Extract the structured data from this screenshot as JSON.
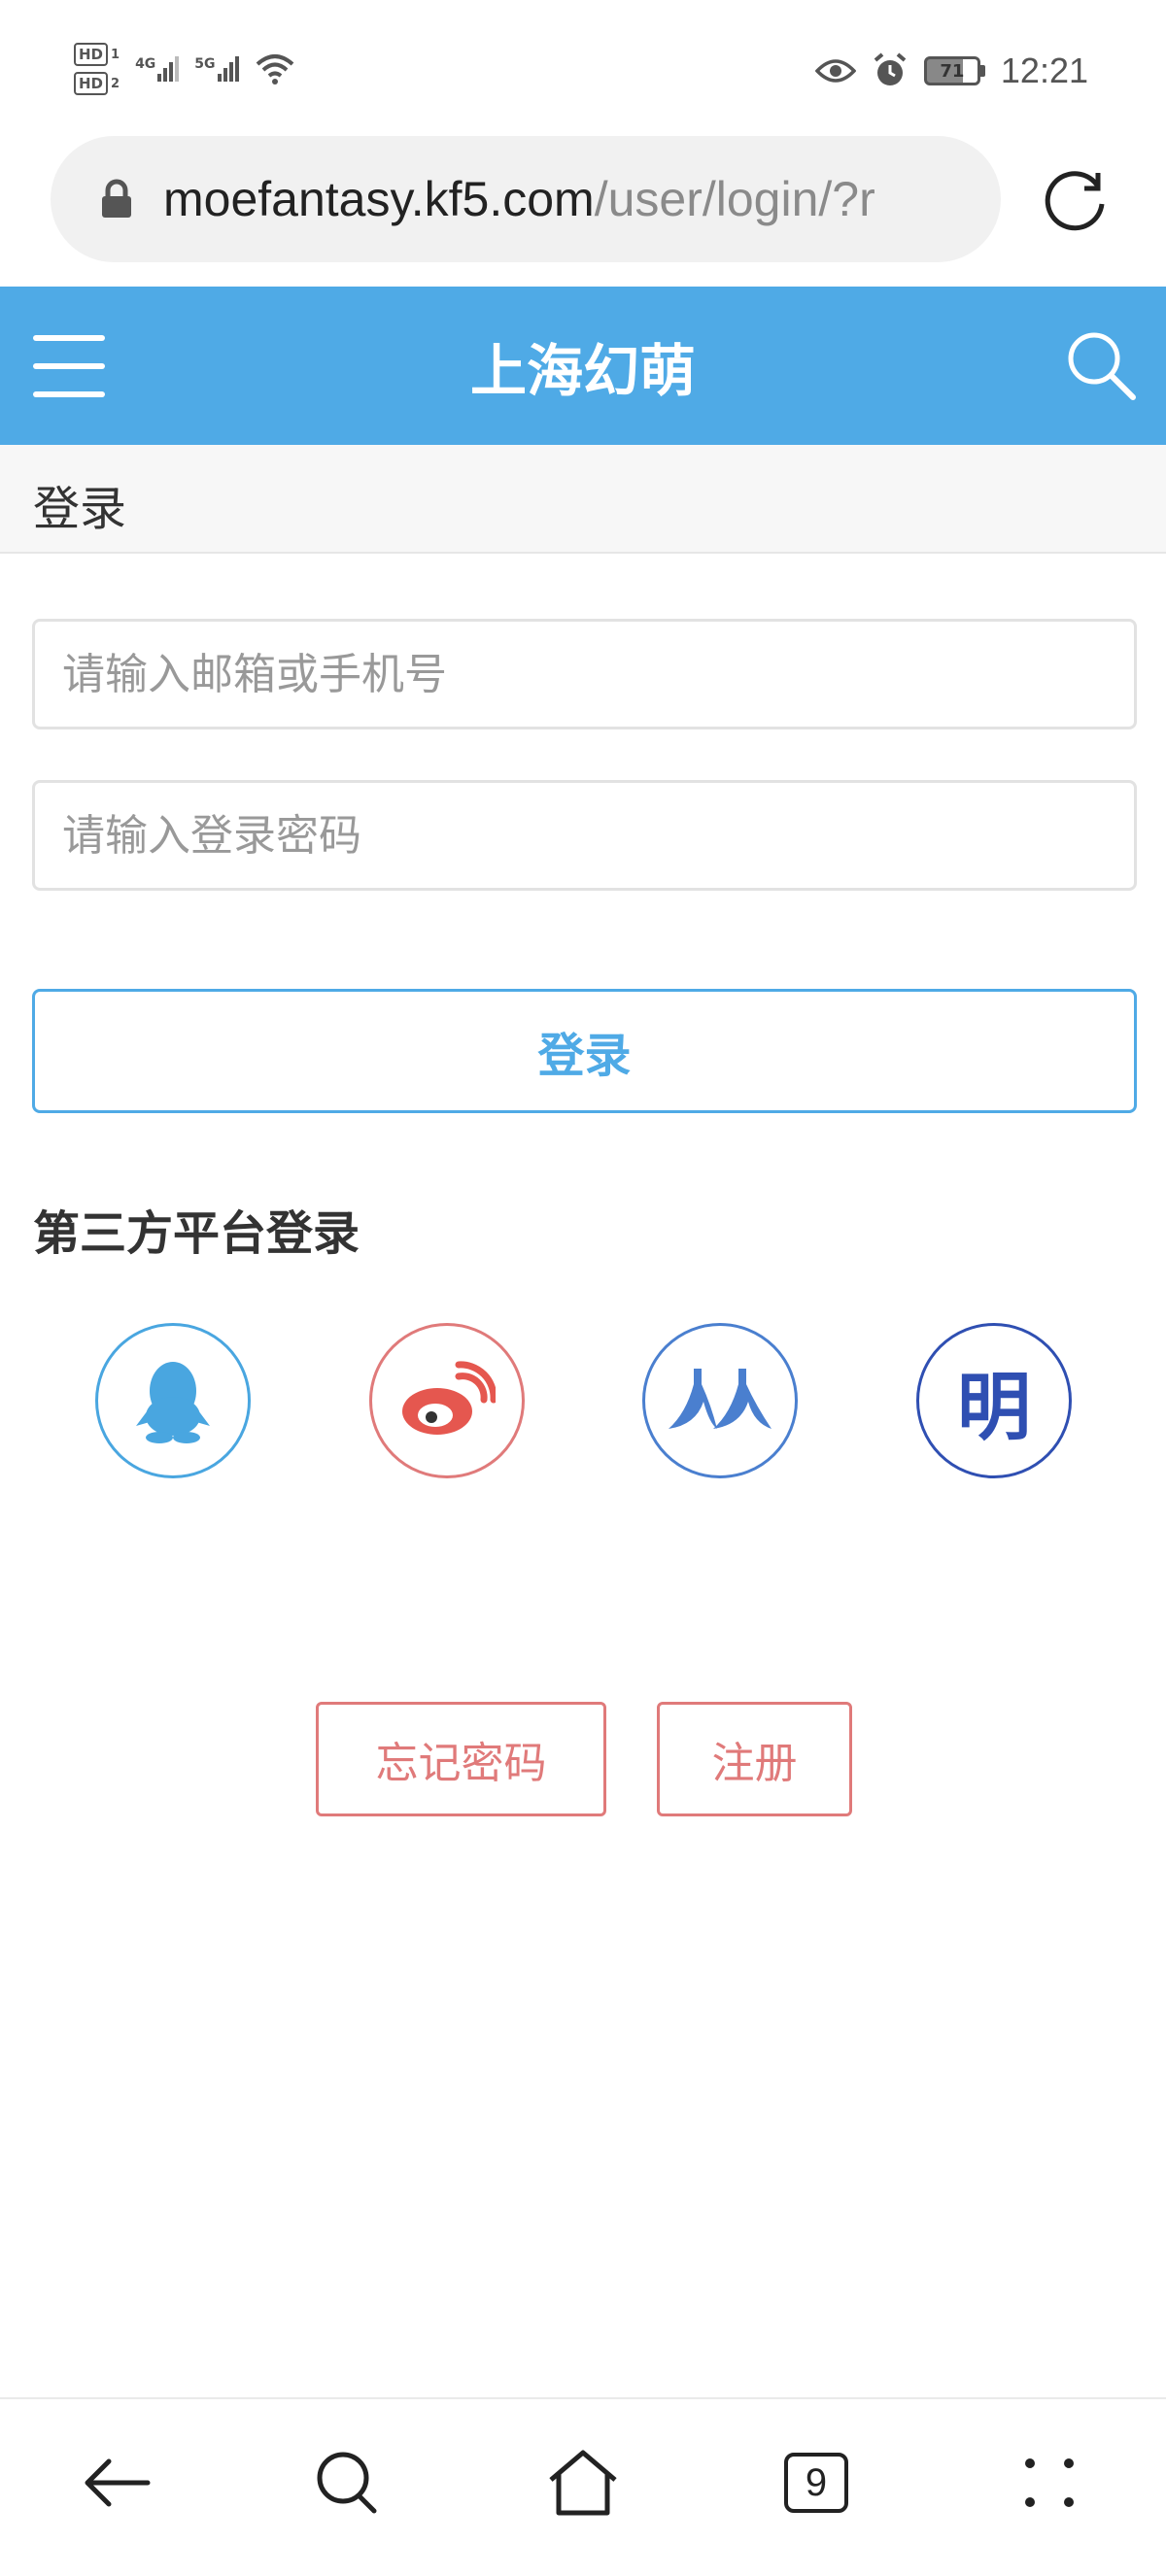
{
  "status_bar": {
    "sim1": "HD",
    "sim1_slot": "1",
    "sim2": "HD",
    "sim2_slot": "2",
    "net1": "4G",
    "net2": "5G",
    "battery": "71",
    "time": "12:21"
  },
  "browser": {
    "url_domain": "moefantasy.kf5.com",
    "url_path": "/user/login/?r",
    "tab_count": "9"
  },
  "header": {
    "title": "上海幻萌"
  },
  "breadcrumb": {
    "label": "登录"
  },
  "form": {
    "account_placeholder": "请输入邮箱或手机号",
    "password_placeholder": "请输入登录密码",
    "login_label": "登录"
  },
  "third_party": {
    "title": "第三方平台登录",
    "providers": [
      "qq-icon",
      "weibo-icon",
      "renren-icon",
      "ming"
    ],
    "ming_char": "明"
  },
  "links": {
    "forgot": "忘记密码",
    "register": "注册"
  },
  "colors": {
    "header": "#4faae6",
    "accent": "#4faae6",
    "link": "#e07a7a",
    "qq": "#49a6e0",
    "weibo": "#e07a7a",
    "renren": "#4a7fcf",
    "ming": "#2f4fb2"
  }
}
